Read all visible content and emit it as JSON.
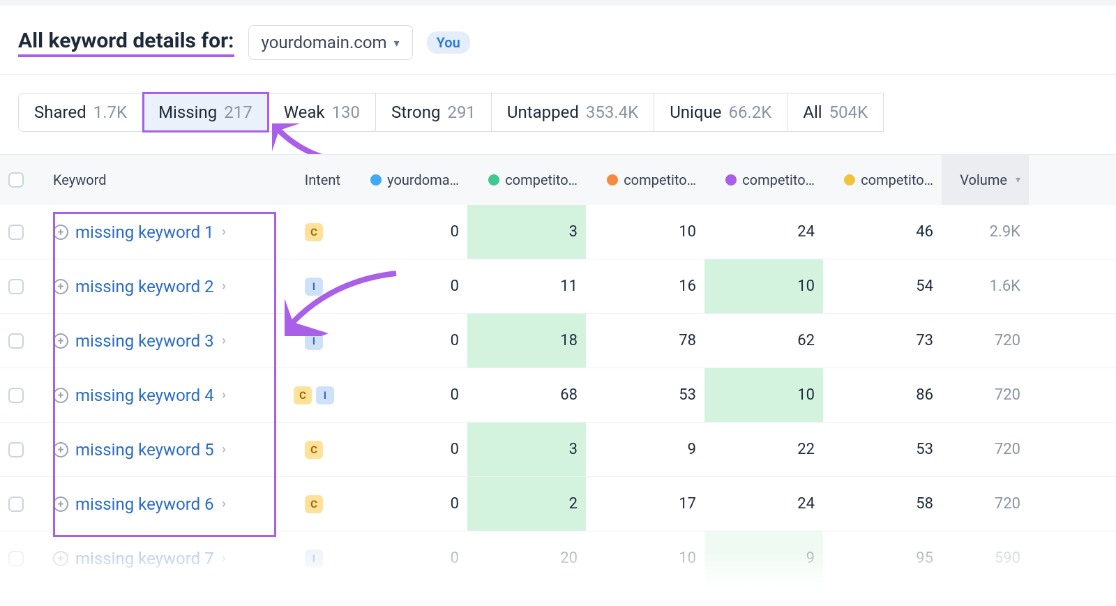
{
  "header": {
    "title": "All keyword details for:",
    "domain": "yourdomain.com",
    "you_badge": "You"
  },
  "filters": [
    {
      "label": "Shared",
      "count": "1.7K",
      "active": false
    },
    {
      "label": "Missing",
      "count": "217",
      "active": true
    },
    {
      "label": "Weak",
      "count": "130",
      "active": false
    },
    {
      "label": "Strong",
      "count": "291",
      "active": false
    },
    {
      "label": "Untapped",
      "count": "353.4K",
      "active": false
    },
    {
      "label": "Unique",
      "count": "66.2K",
      "active": false
    },
    {
      "label": "All",
      "count": "504K",
      "active": false
    }
  ],
  "columns": {
    "keyword": "Keyword",
    "intent": "Intent",
    "yourdomain": "yourdoma…",
    "comp1": "competito…",
    "comp2": "competito…",
    "comp3": "competito…",
    "comp4": "competito…",
    "volume": "Volume"
  },
  "column_colors": {
    "yourdomain": "#3fa9f5",
    "comp1": "#3ec98f",
    "comp2": "#f58a3c",
    "comp3": "#a95fe8",
    "comp4": "#f2c23a"
  },
  "rows": [
    {
      "kw": "missing keyword 1",
      "intents": [
        "C"
      ],
      "yourdomain": "0",
      "c1": "3",
      "c2": "10",
      "c3": "24",
      "c4": "46",
      "vol": "2.9K",
      "green_col": "c1"
    },
    {
      "kw": "missing keyword 2",
      "intents": [
        "I"
      ],
      "yourdomain": "0",
      "c1": "11",
      "c2": "16",
      "c3": "10",
      "c4": "54",
      "vol": "1.6K",
      "green_col": "c3"
    },
    {
      "kw": "missing keyword 3",
      "intents": [
        "I"
      ],
      "yourdomain": "0",
      "c1": "18",
      "c2": "78",
      "c3": "62",
      "c4": "73",
      "vol": "720",
      "green_col": "c1"
    },
    {
      "kw": "missing keyword 4",
      "intents": [
        "C",
        "I"
      ],
      "yourdomain": "0",
      "c1": "68",
      "c2": "53",
      "c3": "10",
      "c4": "86",
      "vol": "720",
      "green_col": "c3"
    },
    {
      "kw": "missing keyword 5",
      "intents": [
        "C"
      ],
      "yourdomain": "0",
      "c1": "3",
      "c2": "9",
      "c3": "22",
      "c4": "53",
      "vol": "720",
      "green_col": "c1"
    },
    {
      "kw": "missing keyword 6",
      "intents": [
        "C"
      ],
      "yourdomain": "0",
      "c1": "2",
      "c2": "17",
      "c3": "24",
      "c4": "58",
      "vol": "720",
      "green_col": "c1"
    },
    {
      "kw": "missing keyword 7",
      "intents": [
        "I"
      ],
      "yourdomain": "0",
      "c1": "20",
      "c2": "10",
      "c3": "9",
      "c4": "95",
      "vol": "590",
      "green_col": "c3",
      "faded": true
    }
  ]
}
